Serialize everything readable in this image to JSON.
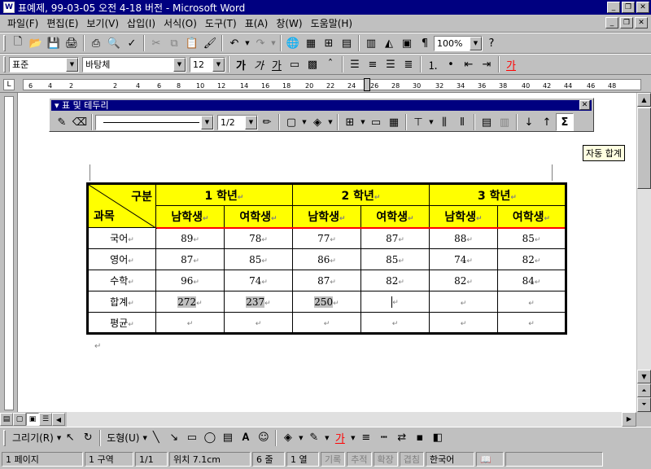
{
  "window": {
    "title": "표예제, 99-03-05 오전 4-18 버전 - Microsoft Word"
  },
  "menu": {
    "items": [
      "파일(F)",
      "편집(E)",
      "보기(V)",
      "삽입(I)",
      "서식(O)",
      "도구(T)",
      "표(A)",
      "창(W)",
      "도움말(H)"
    ]
  },
  "standard_toolbar": {
    "zoom": "100%"
  },
  "format_toolbar": {
    "style": "표준",
    "font": "바탕체",
    "size": "12",
    "bold": "가",
    "italic": "가",
    "underline": "가"
  },
  "ruler": {
    "ticks": [
      "6",
      "4",
      "2",
      "2",
      "4",
      "6",
      "8",
      "10",
      "12",
      "14",
      "16",
      "18",
      "20",
      "22",
      "24",
      "26",
      "28",
      "30",
      "32",
      "34",
      "36",
      "38",
      "40",
      "42",
      "44",
      "46",
      "48"
    ]
  },
  "float_toolbar": {
    "title": "표 및 테두리",
    "line_width": "1/2",
    "autosum_tooltip": "자동 합계"
  },
  "table": {
    "corner_top": "구분",
    "corner_bottom": "과목",
    "grades": [
      "1 학년",
      "2 학년",
      "3 학년"
    ],
    "genders": [
      "남학생",
      "여학생",
      "남학생",
      "여학생",
      "남학생",
      "여학생"
    ],
    "rows": [
      {
        "subject": "국어",
        "values": [
          "89",
          "78",
          "77",
          "87",
          "88",
          "85"
        ]
      },
      {
        "subject": "영어",
        "values": [
          "87",
          "85",
          "86",
          "85",
          "74",
          "82"
        ]
      },
      {
        "subject": "수학",
        "values": [
          "96",
          "74",
          "87",
          "82",
          "82",
          "84"
        ]
      },
      {
        "subject": "합계",
        "values": [
          "272",
          "237",
          "250",
          "",
          "",
          ""
        ]
      },
      {
        "subject": "평균",
        "values": [
          "",
          "",
          "",
          "",
          "",
          ""
        ]
      }
    ]
  },
  "drawing_toolbar": {
    "draw": "그리기(R)",
    "autoshapes": "도형(U)"
  },
  "status": {
    "page": "1 페이지",
    "section": "1 구역",
    "pages": "1/1",
    "position": "위치 7.1cm",
    "line": "6 줄",
    "column": "1 열",
    "rec": "기록",
    "trk": "추적",
    "ext": "확장",
    "ovr": "겹침",
    "language": "한국어"
  }
}
